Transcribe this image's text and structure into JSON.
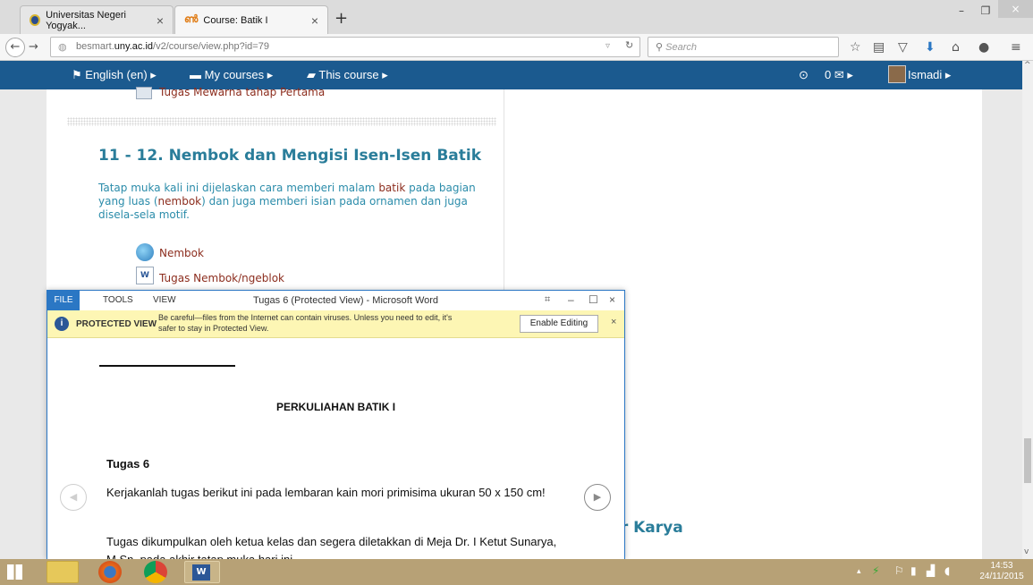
{
  "browser": {
    "tabs": [
      {
        "label": "Universitas Negeri Yogyak...",
        "close": "×"
      },
      {
        "label": "Course: Batik I",
        "close": "×"
      }
    ],
    "new_tab": "+",
    "url_prefix": "besmart.",
    "url_domain": "uny.ac.id",
    "url_path": "/v2/course/view.php?id=79",
    "search_placeholder": "Search",
    "window_controls": {
      "minimize": "–",
      "restore": "❐",
      "close": "×"
    }
  },
  "moodle_nav": {
    "language": "English (en)",
    "my_courses": "My courses",
    "this_course": "This course",
    "messages": "0",
    "user": "Ismadi"
  },
  "course": {
    "prev_activity": "Tugas Mewarna tahap Pertama",
    "section_title": "11 - 12. Nembok dan Mengisi Isen-Isen Batik",
    "summary_parts": [
      "Tatap muka kali ini dijelaskan cara memberi malam ",
      "batik",
      " pada bagian yang luas (",
      "nembok",
      ") dan juga memberi isian pada ornamen dan juga disela-sela motif."
    ],
    "activities": [
      {
        "label": "Nembok",
        "icon": "url-icon"
      },
      {
        "label": "Tugas Nembok/ngeblok",
        "icon": "word-doc-icon"
      }
    ],
    "partial_heading": "ir Karya"
  },
  "word": {
    "file_tab": "FILE",
    "menu_tools": "TOOLS",
    "menu_view": "VIEW",
    "title": "Tugas 6 (Protected View) - Microsoft Word",
    "protected_label": "PROTECTED VIEW",
    "protected_message_line1": "Be careful—files from the Internet can contain viruses. Unless you need to edit, it's",
    "protected_message_line2": "safer to stay in Protected View.",
    "enable_editing": "Enable Editing",
    "doc_heading": "PERKULIAHAN BATIK I",
    "doc_subheading": "Tugas 6",
    "paragraph1": "Kerjakanlah tugas berikut ini pada lembaran kain mori primisima ukuran 50 x 150 cm!",
    "paragraph2": "Tugas dikumpulkan oleh ketua kelas dan segera diletakkan di Meja Dr. I Ketut Sunarya, M.Sn. pada akhir tatap muka hari ini."
  },
  "taskbar": {
    "time": "14:53",
    "date": "24/11/2015"
  },
  "colors": {
    "moodle_bar": "#1b5a8f",
    "section_title": "#2a7d9a",
    "activity_link": "#8c2d1e",
    "word_accent": "#2b77c4",
    "protected_bar": "#fdf6b4",
    "taskbar": "#b7a176"
  }
}
